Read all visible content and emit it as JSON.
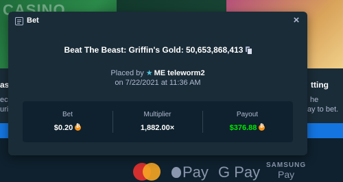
{
  "background": {
    "banner_left_word": "CASINO",
    "fragments": {
      "left_card_title": "as",
      "left_card_line1": "ec",
      "left_card_line2": "uri",
      "right_card_title": "tting",
      "right_card_line1": "he",
      "right_card_line2": "way to bet."
    },
    "payments": {
      "apple_pay": "Pay",
      "google_pay": "G Pay",
      "samsung_pay_line1": "SAMSUNG",
      "samsung_pay_line2": "Pay"
    }
  },
  "modal": {
    "title": "Bet",
    "close_label": "×",
    "game_line": "Beat The Beast: Griffin's Gold: 50,653,868,413",
    "placed_by_prefix": "Placed by",
    "username": "ME teleworm2",
    "date_line": "on 7/22/2021 at 11:36 AM",
    "stats": {
      "bet_label": "Bet",
      "bet_value": "$0.20",
      "multiplier_label": "Multiplier",
      "multiplier_value": "1,882.00×",
      "payout_label": "Payout",
      "payout_value": "$376.88"
    }
  },
  "colors": {
    "modal_bg": "#1a2c38",
    "panel_bg": "#0f212e",
    "payout_green": "#00e701",
    "accent_blue": "#1475e1",
    "coin_orange": "#f7931a"
  },
  "icons": {
    "modal_icon": "receipt-icon",
    "copy": "copy-icon",
    "user_badge": "star-icon",
    "currency": "bitcoin-coin-icon",
    "close": "close-icon"
  }
}
